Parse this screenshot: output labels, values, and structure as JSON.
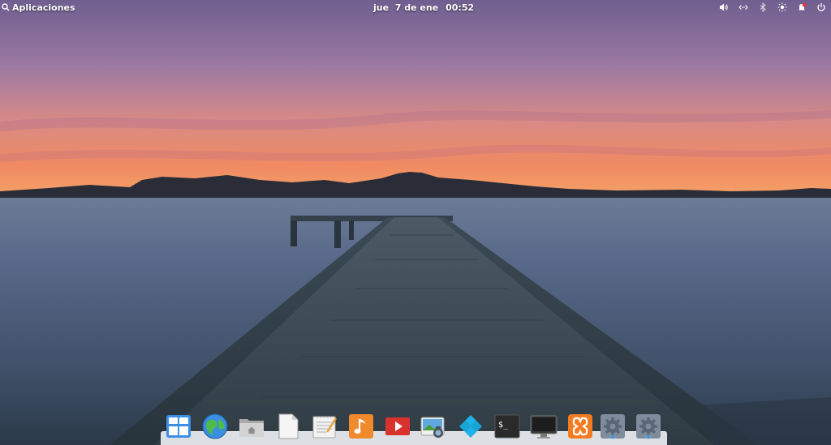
{
  "panel": {
    "applications_label": "Aplicaciones",
    "date": "jue  7 de ene",
    "time": "00:52",
    "indicators": [
      {
        "name": "volume-icon"
      },
      {
        "name": "network-icon"
      },
      {
        "name": "bluetooth-icon"
      },
      {
        "name": "brightness-icon"
      },
      {
        "name": "notifications-icon",
        "accent": "#e0393e"
      },
      {
        "name": "power-icon"
      }
    ]
  },
  "dock": {
    "apps": [
      {
        "name": "multitasking-view",
        "icon": "multitasking-icon",
        "color": "#3d8ee6",
        "running": false
      },
      {
        "name": "web-browser",
        "icon": "globe-icon",
        "color": "#3fa548",
        "running": false
      },
      {
        "name": "files",
        "icon": "home-folder-icon",
        "color": "#c8c8c8",
        "running": false
      },
      {
        "name": "document-viewer",
        "icon": "document-icon",
        "color": "#f4f4f4",
        "running": false
      },
      {
        "name": "text-editor",
        "icon": "notepad-icon",
        "color": "#f2f2f2",
        "running": false
      },
      {
        "name": "music",
        "icon": "music-note-icon",
        "color": "#f08a2c",
        "running": false
      },
      {
        "name": "videos",
        "icon": "play-icon",
        "color": "#d9322d",
        "running": false
      },
      {
        "name": "photos",
        "icon": "photos-icon",
        "color": "#5ea7e0",
        "running": false
      },
      {
        "name": "kodi",
        "icon": "kodi-icon",
        "color": "#1fb2e8",
        "running": false
      },
      {
        "name": "terminal",
        "icon": "terminal-icon",
        "color": "#2a2a2a",
        "running": false
      },
      {
        "name": "display",
        "icon": "monitor-icon",
        "color": "#3a3a3a",
        "running": false
      },
      {
        "name": "xampp",
        "icon": "xampp-icon",
        "color": "#f47b20",
        "running": false
      },
      {
        "name": "system-settings-1",
        "icon": "gear-icon",
        "color": "#7e8c9c",
        "running": true
      },
      {
        "name": "system-settings-2",
        "icon": "gear-icon",
        "color": "#7e8c9c",
        "running": true
      }
    ]
  }
}
